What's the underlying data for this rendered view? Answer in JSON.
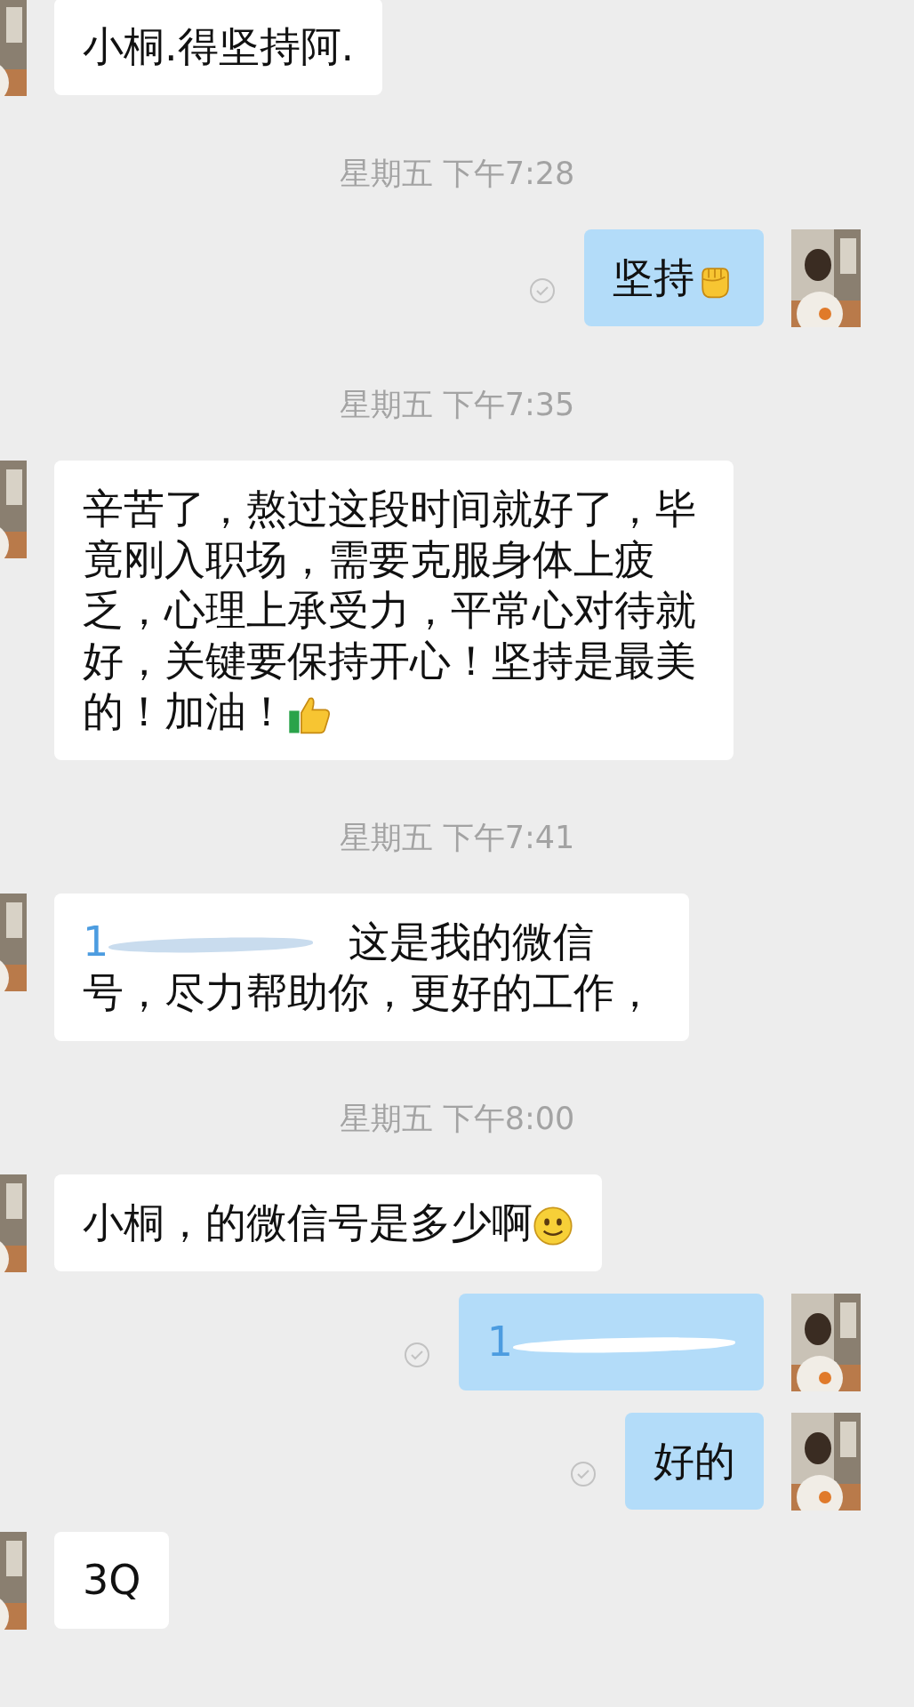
{
  "messages": [
    {
      "kind": "text",
      "outgoing": false,
      "text": "小桐.得坚持阿."
    },
    {
      "kind": "time",
      "text": "星期五 下午7:28"
    },
    {
      "kind": "text",
      "outgoing": true,
      "text": "坚持",
      "emoji": {
        "kind": "fist"
      },
      "read": true
    },
    {
      "kind": "time",
      "text": "星期五 下午7:35"
    },
    {
      "kind": "text",
      "outgoing": false,
      "text": "辛苦了，熬过这段时间就好了，毕竟刚入职场，需要克服身体上疲乏，心理上承受力，平常心对待就好，关键要保持开心！坚持是最美的！加油！",
      "emoji": {
        "kind": "thumbs"
      }
    },
    {
      "kind": "time",
      "text": "星期五 下午7:41"
    },
    {
      "kind": "number",
      "outgoing": false,
      "number": "1",
      "text": "这是我的微信号，尽力帮助你，更好的工作，"
    },
    {
      "kind": "time",
      "text": "星期五 下午8:00"
    },
    {
      "kind": "text",
      "outgoing": false,
      "text": "小桐，的微信号是多少啊",
      "emoji": {
        "kind": "smiley"
      }
    },
    {
      "kind": "number",
      "outgoing": true,
      "number": "1",
      "read": true
    },
    {
      "kind": "text",
      "outgoing": true,
      "text": "好的",
      "read": true
    },
    {
      "kind": "text",
      "outgoing": false,
      "text": "3Q"
    }
  ]
}
